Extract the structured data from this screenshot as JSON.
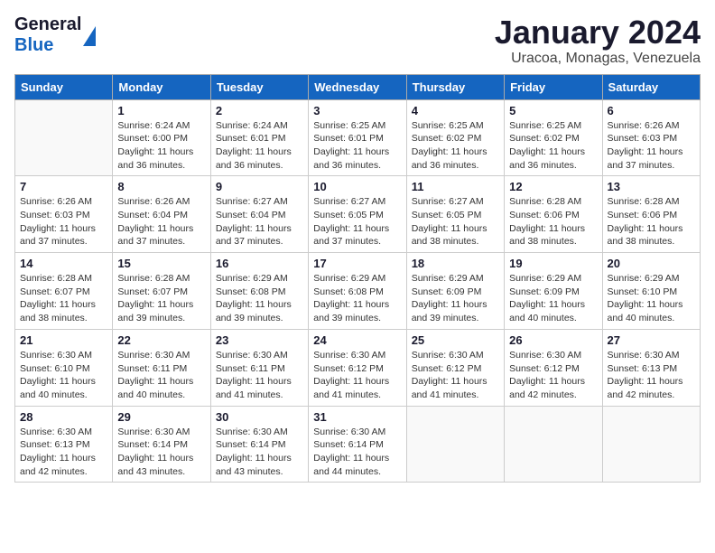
{
  "logo": {
    "general": "General",
    "blue": "Blue"
  },
  "header": {
    "title": "January 2024",
    "subtitle": "Uracoa, Monagas, Venezuela"
  },
  "weekdays": [
    "Sunday",
    "Monday",
    "Tuesday",
    "Wednesday",
    "Thursday",
    "Friday",
    "Saturday"
  ],
  "weeks": [
    [
      {
        "day": "",
        "info": ""
      },
      {
        "day": "1",
        "info": "Sunrise: 6:24 AM\nSunset: 6:00 PM\nDaylight: 11 hours and 36 minutes."
      },
      {
        "day": "2",
        "info": "Sunrise: 6:24 AM\nSunset: 6:01 PM\nDaylight: 11 hours and 36 minutes."
      },
      {
        "day": "3",
        "info": "Sunrise: 6:25 AM\nSunset: 6:01 PM\nDaylight: 11 hours and 36 minutes."
      },
      {
        "day": "4",
        "info": "Sunrise: 6:25 AM\nSunset: 6:02 PM\nDaylight: 11 hours and 36 minutes."
      },
      {
        "day": "5",
        "info": "Sunrise: 6:25 AM\nSunset: 6:02 PM\nDaylight: 11 hours and 36 minutes."
      },
      {
        "day": "6",
        "info": "Sunrise: 6:26 AM\nSunset: 6:03 PM\nDaylight: 11 hours and 37 minutes."
      }
    ],
    [
      {
        "day": "7",
        "info": "Sunrise: 6:26 AM\nSunset: 6:03 PM\nDaylight: 11 hours and 37 minutes."
      },
      {
        "day": "8",
        "info": "Sunrise: 6:26 AM\nSunset: 6:04 PM\nDaylight: 11 hours and 37 minutes."
      },
      {
        "day": "9",
        "info": "Sunrise: 6:27 AM\nSunset: 6:04 PM\nDaylight: 11 hours and 37 minutes."
      },
      {
        "day": "10",
        "info": "Sunrise: 6:27 AM\nSunset: 6:05 PM\nDaylight: 11 hours and 37 minutes."
      },
      {
        "day": "11",
        "info": "Sunrise: 6:27 AM\nSunset: 6:05 PM\nDaylight: 11 hours and 38 minutes."
      },
      {
        "day": "12",
        "info": "Sunrise: 6:28 AM\nSunset: 6:06 PM\nDaylight: 11 hours and 38 minutes."
      },
      {
        "day": "13",
        "info": "Sunrise: 6:28 AM\nSunset: 6:06 PM\nDaylight: 11 hours and 38 minutes."
      }
    ],
    [
      {
        "day": "14",
        "info": "Sunrise: 6:28 AM\nSunset: 6:07 PM\nDaylight: 11 hours and 38 minutes."
      },
      {
        "day": "15",
        "info": "Sunrise: 6:28 AM\nSunset: 6:07 PM\nDaylight: 11 hours and 39 minutes."
      },
      {
        "day": "16",
        "info": "Sunrise: 6:29 AM\nSunset: 6:08 PM\nDaylight: 11 hours and 39 minutes."
      },
      {
        "day": "17",
        "info": "Sunrise: 6:29 AM\nSunset: 6:08 PM\nDaylight: 11 hours and 39 minutes."
      },
      {
        "day": "18",
        "info": "Sunrise: 6:29 AM\nSunset: 6:09 PM\nDaylight: 11 hours and 39 minutes."
      },
      {
        "day": "19",
        "info": "Sunrise: 6:29 AM\nSunset: 6:09 PM\nDaylight: 11 hours and 40 minutes."
      },
      {
        "day": "20",
        "info": "Sunrise: 6:29 AM\nSunset: 6:10 PM\nDaylight: 11 hours and 40 minutes."
      }
    ],
    [
      {
        "day": "21",
        "info": "Sunrise: 6:30 AM\nSunset: 6:10 PM\nDaylight: 11 hours and 40 minutes."
      },
      {
        "day": "22",
        "info": "Sunrise: 6:30 AM\nSunset: 6:11 PM\nDaylight: 11 hours and 40 minutes."
      },
      {
        "day": "23",
        "info": "Sunrise: 6:30 AM\nSunset: 6:11 PM\nDaylight: 11 hours and 41 minutes."
      },
      {
        "day": "24",
        "info": "Sunrise: 6:30 AM\nSunset: 6:12 PM\nDaylight: 11 hours and 41 minutes."
      },
      {
        "day": "25",
        "info": "Sunrise: 6:30 AM\nSunset: 6:12 PM\nDaylight: 11 hours and 41 minutes."
      },
      {
        "day": "26",
        "info": "Sunrise: 6:30 AM\nSunset: 6:12 PM\nDaylight: 11 hours and 42 minutes."
      },
      {
        "day": "27",
        "info": "Sunrise: 6:30 AM\nSunset: 6:13 PM\nDaylight: 11 hours and 42 minutes."
      }
    ],
    [
      {
        "day": "28",
        "info": "Sunrise: 6:30 AM\nSunset: 6:13 PM\nDaylight: 11 hours and 42 minutes."
      },
      {
        "day": "29",
        "info": "Sunrise: 6:30 AM\nSunset: 6:14 PM\nDaylight: 11 hours and 43 minutes."
      },
      {
        "day": "30",
        "info": "Sunrise: 6:30 AM\nSunset: 6:14 PM\nDaylight: 11 hours and 43 minutes."
      },
      {
        "day": "31",
        "info": "Sunrise: 6:30 AM\nSunset: 6:14 PM\nDaylight: 11 hours and 44 minutes."
      },
      {
        "day": "",
        "info": ""
      },
      {
        "day": "",
        "info": ""
      },
      {
        "day": "",
        "info": ""
      }
    ]
  ]
}
